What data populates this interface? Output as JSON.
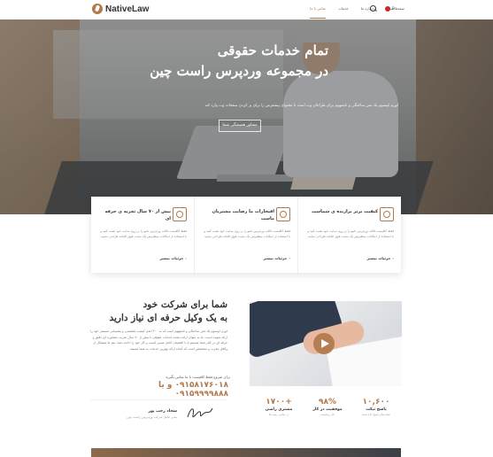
{
  "header": {
    "logo_text": "NativeLaw",
    "nav": [
      {
        "label": "صفحه اصلی",
        "active": false
      },
      {
        "label": "درباره ما",
        "active": false
      },
      {
        "label": "خدمات",
        "active": false
      },
      {
        "label": "تماس با ما",
        "active": true
      }
    ],
    "language": "En"
  },
  "hero": {
    "title_line1": "تمام خدمات حقوقی",
    "title_line2": "در مجموعه وردپرس راست چین",
    "subtitle": "لورم ایپسوم یک متن ساختگی و نامفهوم برای طراحان وب است تا محتوای پیشفرض را برای پر کردن صفحات وب وارد کند",
    "button_label": "مشاور همیشگی شما"
  },
  "features": [
    {
      "title": "کیفیت برتر برازنده ی شماست",
      "desc": "فقط کافیست قالب وردپرس ناتیو را بر روی سایت خود نصب کنید و با استفاده از امکانات بینظیرش یک سایت فوق العاده طراحی نمایید",
      "link": "جزئیات بیشتر"
    },
    {
      "title": "افتخارات ما رضایت مشتریان ماست",
      "desc": "فقط کافیست قالب وردپرس ناتیو را بر روی سایت خود نصب کنید و با استفاده از امکانات بینظیرش یک سایت فوق العاده طراحی نمایید",
      "link": "جزئیات بیشتر"
    },
    {
      "title": "بیش از ۷۰ سال تجربه ی حرفه ای",
      "desc": "فقط کافیست قالب وردپرس ناتیو را بر روی سایت خود نصب کنید و با استفاده از امکانات بینظیرش یک سایت فوق العاده طراحی نمایید",
      "link": "جزئیات بیشتر"
    }
  ],
  "about": {
    "title_line1": "شما برای شرکت خود",
    "title_line2": "به یک وکیل حرفه ای نیاز دارید",
    "text": "لورم ایپسوم یک متن ساختگی و نامفهوم است که به ۳۰۰ اصل کیفیت تخصصی و پشتیبانی مستمر خود را ارائه نموده است. ما به عنوان ارائه دهنده خدمات حقوقی با بیش از ۷۰ سال تجربه، مشاوره ای دقیق و حرفه ای در کنار شما هستیم تا با اطمینان کامل مسیر کسب و کار خود را ادامه دهید. تیم ما متشکل از وکلای مجرب و متخصص است که آماده ارائه بهترین خدمات به شما هستند.",
    "call_label": "برای شروع فقط کافیست با ما تماس بگیرید",
    "phones": "۰۹۱۵۸۱۷۶۰۱۸ و یا ۰۹۱۵۹۹۹۹۸۸۸",
    "signer_name": "سجاد رجب پور",
    "signer_role": "مدیر عامل شرکت وردپرس راست چین"
  },
  "stats": [
    {
      "value": "۱۰,۶۰۰",
      "label": "پاسخ تیکت",
      "desc": "تیکت های پاسخ داده شده"
    },
    {
      "value": "۹۸%",
      "label": "موفقیت در کار",
      "desc": "کار رضایتمند"
    },
    {
      "value": "+۱۷۰۰",
      "label": "مشتری راضی",
      "desc": "در تمامی زمینه ها"
    }
  ],
  "colors": {
    "accent": "#b37a4c",
    "text": "#333333"
  }
}
